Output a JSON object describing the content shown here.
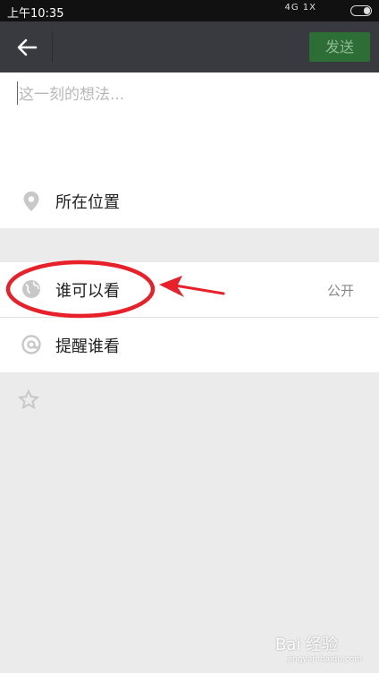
{
  "status_bar": {
    "time": "上午10:35",
    "signal_text": "4G 1X"
  },
  "app_bar": {
    "send_label": "发送",
    "back_icon": "back-arrow-icon"
  },
  "editor": {
    "placeholder": "这一刻的想法..."
  },
  "location": {
    "label": "所在位置",
    "icon": "location-pin-icon"
  },
  "visibility": {
    "label": "谁可以看",
    "value": "公开",
    "icon": "globe-icon"
  },
  "mention": {
    "label": "提醒谁看",
    "icon": "at-icon"
  },
  "extra": {
    "icon": "star-icon"
  },
  "watermark": {
    "text": "Bai 经验",
    "sub": "jingyan.baidu.com"
  },
  "colors": {
    "appbar": "#393a3f",
    "send_bg": "#2c6e35",
    "annotation": "#e8202a",
    "page_bg": "#ebebeb"
  }
}
